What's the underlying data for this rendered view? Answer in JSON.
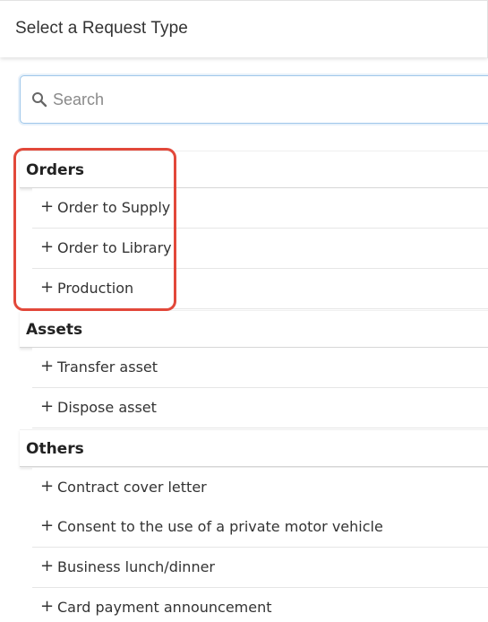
{
  "header": {
    "title": "Select a Request Type"
  },
  "search": {
    "placeholder": "Search",
    "value": ""
  },
  "groups": [
    {
      "title": "Orders",
      "items": [
        {
          "label": "Order to Supply"
        },
        {
          "label": "Order to Library"
        },
        {
          "label": "Production"
        }
      ]
    },
    {
      "title": "Assets",
      "items": [
        {
          "label": "Transfer asset"
        },
        {
          "label": "Dispose asset"
        }
      ]
    },
    {
      "title": "Others",
      "items": [
        {
          "label": "Contract cover letter"
        },
        {
          "label": "Consent to the use of a private motor vehicle"
        },
        {
          "label": "Business lunch/dinner"
        },
        {
          "label": "Card payment announcement"
        }
      ]
    }
  ],
  "item_icon": "plus-icon",
  "highlight": {
    "color": "#e2483a",
    "target": "Orders"
  },
  "colors": {
    "search_border": "#9fc7ea",
    "highlight": "#e2483a"
  }
}
